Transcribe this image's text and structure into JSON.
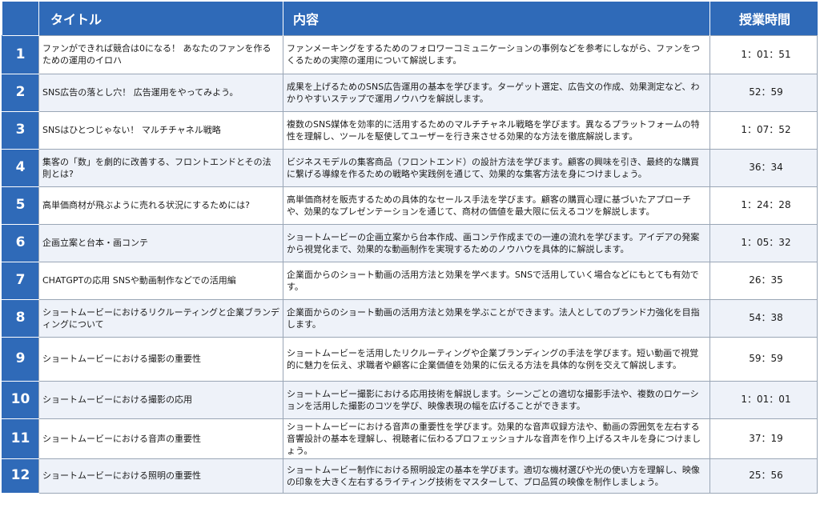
{
  "header": {
    "col_title": "タイトル",
    "col_content": "内容",
    "col_duration": "授業時間"
  },
  "rows": [
    {
      "num": "1",
      "title": "ファンができれば競合は0になる！ あなたのファンを作るための運用のイロハ",
      "content": "ファンメーキングをするためのフォロワーコミュニケーションの事例などを参考にしながら、ファンをつくるための実際の運用について解説します。",
      "duration": "1：01：51"
    },
    {
      "num": "2",
      "title": "SNS広告の落とし穴！ 広告運用をやってみよう。",
      "content": "成果を上げるためのSNS広告運用の基本を学びます。ターゲット選定、広告文の作成、効果測定など、わかりやすいステップで運用ノウハウを解説します。",
      "duration": "52：59"
    },
    {
      "num": "3",
      "title": "SNSはひとつじゃない！ マルチチャネル戦略",
      "content": "複数のSNS媒体を効率的に活用するためのマルチチャネル戦略を学びます。異なるプラットフォームの特性を理解し、ツールを駆使してユーザーを行き来させる効果的な方法を徹底解説します。",
      "duration": "1：07：52"
    },
    {
      "num": "4",
      "title": "集客の「数」を劇的に改善する、フロントエンドとその法則とは?",
      "content": "ビジネスモデルの集客商品（フロントエンド）の設計方法を学びます。顧客の興味を引き、最終的な購買に繋げる導線を作るための戦略や実践例を通じて、効果的な集客方法を身につけましょう。",
      "duration": "36：34"
    },
    {
      "num": "5",
      "title": "高単価商材が飛ぶように売れる状況にするためには?",
      "content": "高単価商材を販売するための具体的なセールス手法を学びます。顧客の購買心理に基づいたアプローチや、効果的なプレゼンテーションを通じて、商材の価値を最大限に伝えるコツを解説します。",
      "duration": "1：24：28"
    },
    {
      "num": "6",
      "title": "企画立案と台本・画コンテ",
      "content": "ショートムービーの企画立案から台本作成、画コンテ作成までの一連の流れを学びます。アイデアの発案から視覚化まで、効果的な動画制作を実現するためのノウハウを具体的に解説します。",
      "duration": "1：05：32"
    },
    {
      "num": "7",
      "title": "CHATGPTの応用 SNSや動画制作などでの活用編",
      "content": "企業面からのショート動画の活用方法と効果を学べます。SNSで活用していく場合などにもとても有効です。",
      "duration": "26：35"
    },
    {
      "num": "8",
      "title": "ショートムービーにおけるリクルーティングと企業ブランディングについて",
      "content": "企業面からのショート動画の活用方法と効果を学ぶことができます。法人としてのブランド力強化を目指します。",
      "duration": "54：38"
    },
    {
      "num": "9",
      "title": "ショートムービーにおける撮影の重要性",
      "content": "ショートムービーを活用したリクルーティングや企業ブランディングの手法を学びます。短い動画で視覚的に魅力を伝え、求職者や顧客に企業価値を効果的に伝える方法を具体的な例を交えて解説します。",
      "duration": "59：59"
    },
    {
      "num": "10",
      "title": "ショートムービーにおける撮影の応用",
      "content": "ショートムービー撮影における応用技術を解説します。シーンごとの適切な撮影手法や、複数のロケーションを活用した撮影のコツを学び、映像表現の幅を広げることができます。",
      "duration": "1：01：01"
    },
    {
      "num": "11",
      "title": "ショートムービーにおける音声の重要性",
      "content": "ショートムービーにおける音声の重要性を学びます。効果的な音声収録方法や、動画の雰囲気を左右する音響設計の基本を理解し、視聴者に伝わるプロフェッショナルな音声を作り上げるスキルを身につけましょう。",
      "duration": "37：19"
    },
    {
      "num": "12",
      "title": "ショートムービーにおける照明の重要性",
      "content": "ショートムービー制作における照明設定の基本を学びます。適切な機材選びや光の使い方を理解し、映像の印象を大きく左右するライティング技術をマスターして、プロ品質の映像を制作しましょう。",
      "duration": "25：56"
    }
  ],
  "colors": {
    "header_bg": "#2f6ab8",
    "row_alt_bg": "#eef2f9",
    "border": "#9aa6b6"
  }
}
